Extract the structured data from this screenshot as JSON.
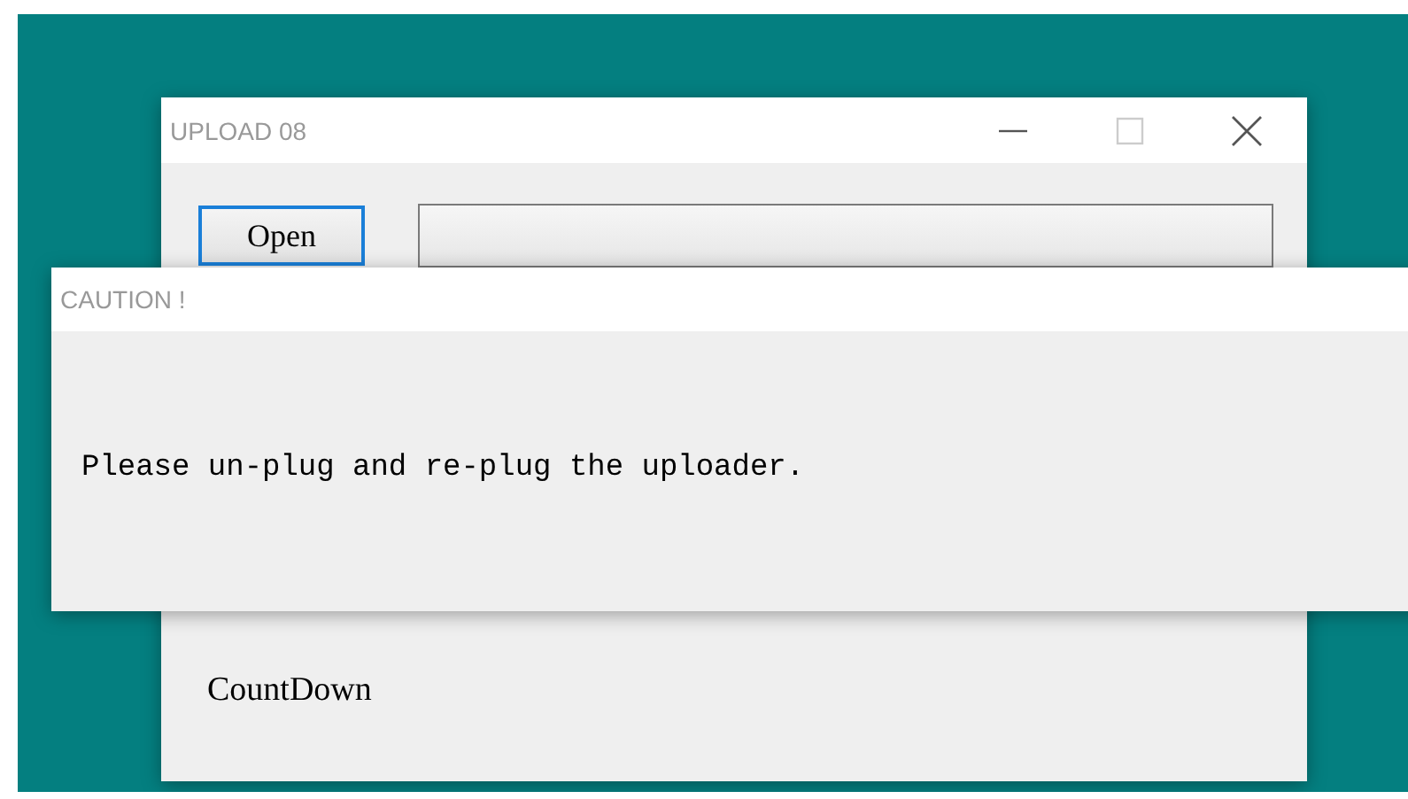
{
  "main_window": {
    "title": "UPLOAD 08",
    "open_button": "Open",
    "countdown_label": "CountDown"
  },
  "dialog": {
    "title": "CAUTION !",
    "message": "Please un-plug and re-plug the uploader."
  }
}
